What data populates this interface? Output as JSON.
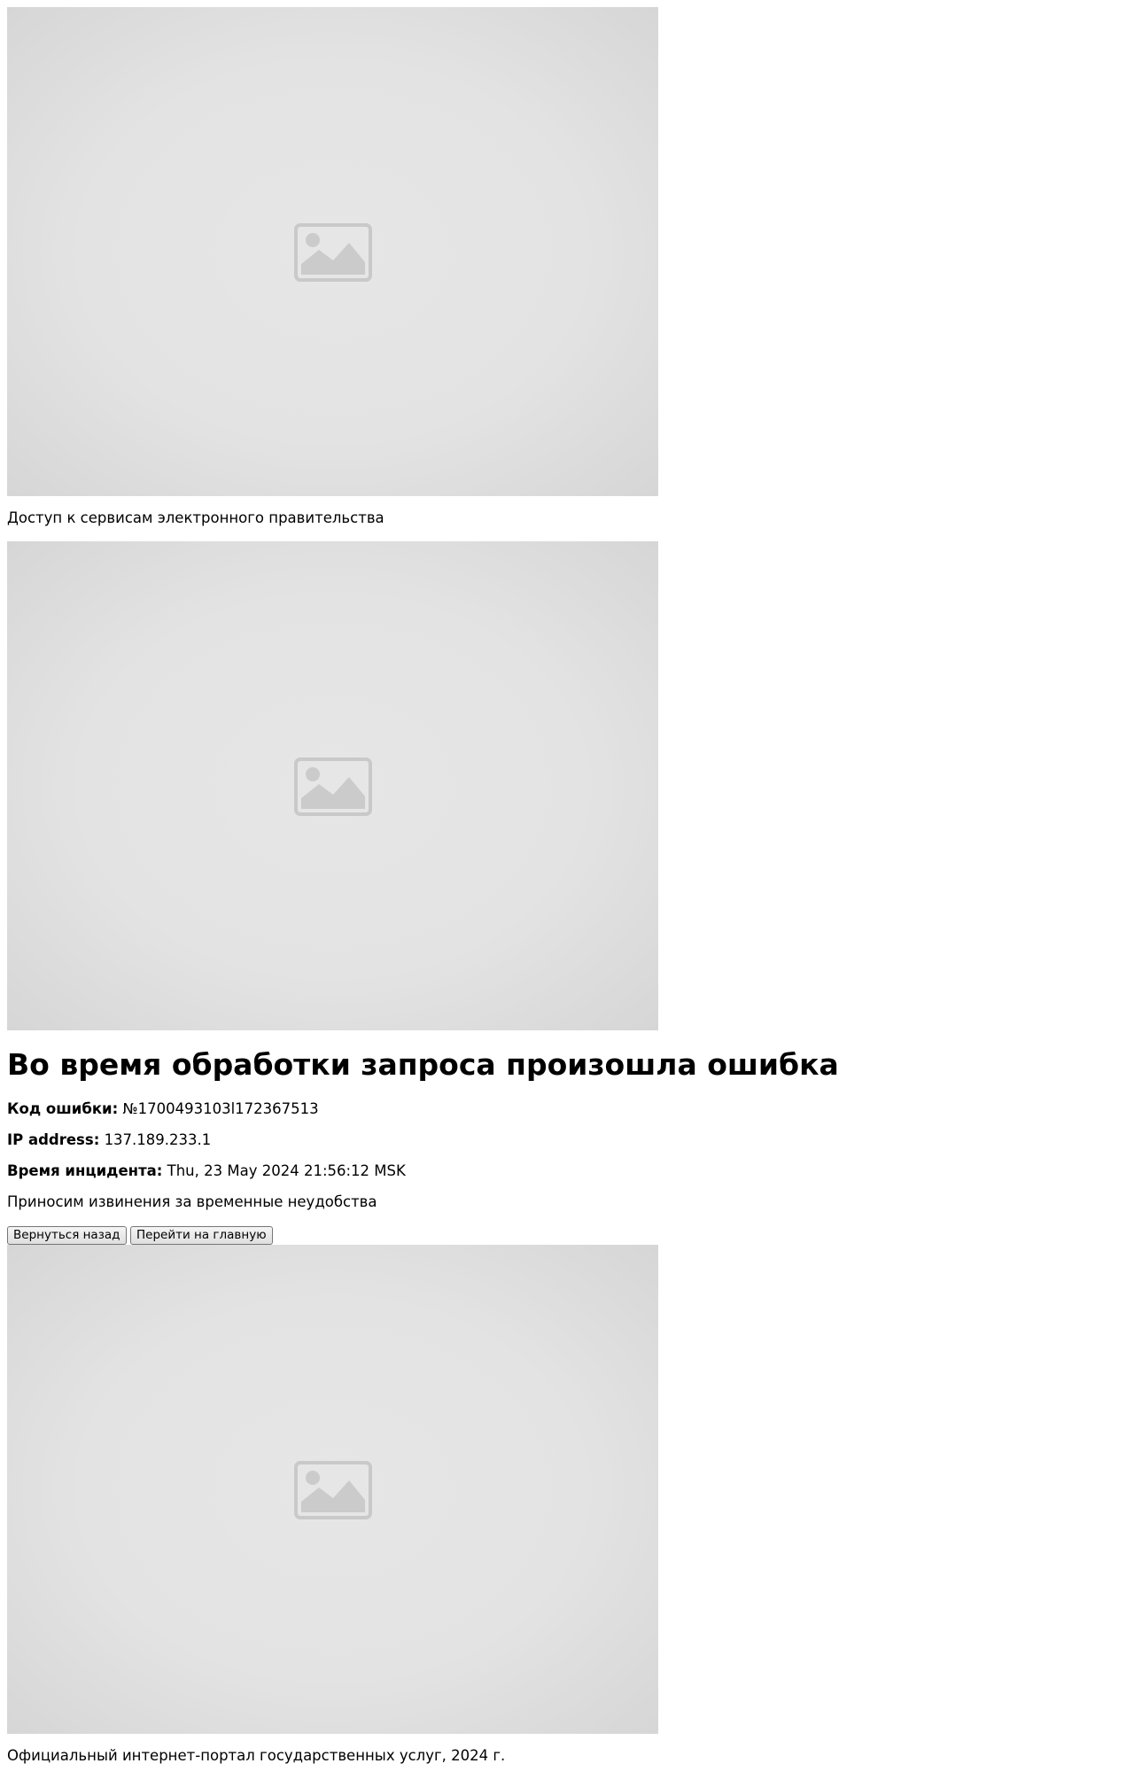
{
  "header": {
    "caption": "Доступ к сервисам электронного правительства"
  },
  "images": [
    {
      "icon": "image-placeholder-icon"
    },
    {
      "icon": "image-placeholder-icon"
    },
    {
      "icon": "image-placeholder-icon"
    }
  ],
  "error": {
    "title": "Во время обработки запроса произошла ошибка",
    "code_label": "Код ошибки:",
    "code_value": "№1700493103l172367513",
    "ip_label": "IP address:",
    "ip_value": "137.189.233.1",
    "time_label": "Время инцидента:",
    "time_value": "Thu, 23 May 2024 21:56:12 MSK",
    "apology": "Приносим извинения за временные неудобства"
  },
  "actions": {
    "back_label": "Вернуться назад",
    "home_label": "Перейти на главную"
  },
  "footer": {
    "text": "Официальный интернет-портал государственных услуг, 2024 г."
  },
  "colors": {
    "placeholder_bg": "#e4e4e4",
    "placeholder_icon": "#c9c9c9"
  }
}
